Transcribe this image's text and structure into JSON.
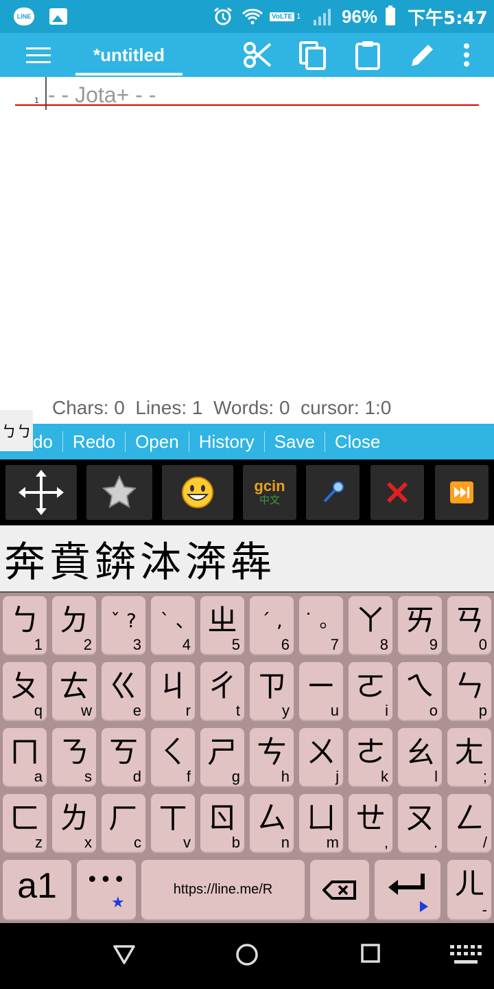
{
  "status_bar": {
    "line_label": "LINE",
    "volte": "VoLTE",
    "sim": "1",
    "battery": "96%",
    "time": "下午5:47"
  },
  "app_bar": {
    "tab_title": "*untitled"
  },
  "editor": {
    "line_number": "1",
    "placeholder": "- - Jota+ - -",
    "status_line": "Chars: 0  Lines: 1  Words: 0  cursor: 1:0"
  },
  "action_bar": {
    "items": [
      "do",
      "Redo",
      "Open",
      "History",
      "Save",
      "Close"
    ],
    "ime_indicator": "ㄅㄅ"
  },
  "toolbar": {
    "gcin_top": "gcin",
    "gcin_bottom": "中文"
  },
  "candidates": [
    "奔",
    "賁",
    "錛",
    "泍",
    "渀",
    "犇"
  ],
  "keyboard": {
    "rows": [
      [
        {
          "main": "ㄅ",
          "sub": "1"
        },
        {
          "main": "ㄉ",
          "sub": "2"
        },
        {
          "main": "ˇ ?",
          "sub": "3"
        },
        {
          "main": "ˋ ､",
          "sub": "4"
        },
        {
          "main": "ㄓ",
          "sub": "5"
        },
        {
          "main": "ˊ ,",
          "sub": "6"
        },
        {
          "main": "˙ 。",
          "sub": "7"
        },
        {
          "main": "ㄚ",
          "sub": "8"
        },
        {
          "main": "ㄞ",
          "sub": "9"
        },
        {
          "main": "ㄢ",
          "sub": "0"
        }
      ],
      [
        {
          "main": "ㄆ",
          "sub": "q"
        },
        {
          "main": "ㄊ",
          "sub": "w"
        },
        {
          "main": "ㄍ",
          "sub": "e"
        },
        {
          "main": "ㄐ",
          "sub": "r"
        },
        {
          "main": "ㄔ",
          "sub": "t"
        },
        {
          "main": "ㄗ",
          "sub": "y"
        },
        {
          "main": "ㄧ",
          "sub": "u"
        },
        {
          "main": "ㄛ",
          "sub": "i"
        },
        {
          "main": "ㄟ",
          "sub": "o"
        },
        {
          "main": "ㄣ",
          "sub": "p"
        }
      ],
      [
        {
          "main": "ㄇ",
          "sub": "a"
        },
        {
          "main": "ㄋ",
          "sub": "s"
        },
        {
          "main": "ㄎ",
          "sub": "d"
        },
        {
          "main": "ㄑ",
          "sub": "f"
        },
        {
          "main": "ㄕ",
          "sub": "g"
        },
        {
          "main": "ㄘ",
          "sub": "h"
        },
        {
          "main": "ㄨ",
          "sub": "j"
        },
        {
          "main": "ㄜ",
          "sub": "k"
        },
        {
          "main": "ㄠ",
          "sub": "l"
        },
        {
          "main": "ㄤ",
          "sub": ";"
        }
      ],
      [
        {
          "main": "ㄈ",
          "sub": "z"
        },
        {
          "main": "ㄌ",
          "sub": "x"
        },
        {
          "main": "ㄏ",
          "sub": "c"
        },
        {
          "main": "ㄒ",
          "sub": "v"
        },
        {
          "main": "ㄖ",
          "sub": "b"
        },
        {
          "main": "ㄙ",
          "sub": "n"
        },
        {
          "main": "ㄩ",
          "sub": "m"
        },
        {
          "main": "ㄝ",
          "sub": ","
        },
        {
          "main": "ㄡ",
          "sub": "."
        },
        {
          "main": "ㄥ",
          "sub": "/"
        }
      ]
    ],
    "bottom": {
      "mode_key": "a1",
      "more_key": "•••",
      "space_text": "https://line.me/R",
      "er_key": "ㄦ",
      "er_sub": "-"
    }
  }
}
